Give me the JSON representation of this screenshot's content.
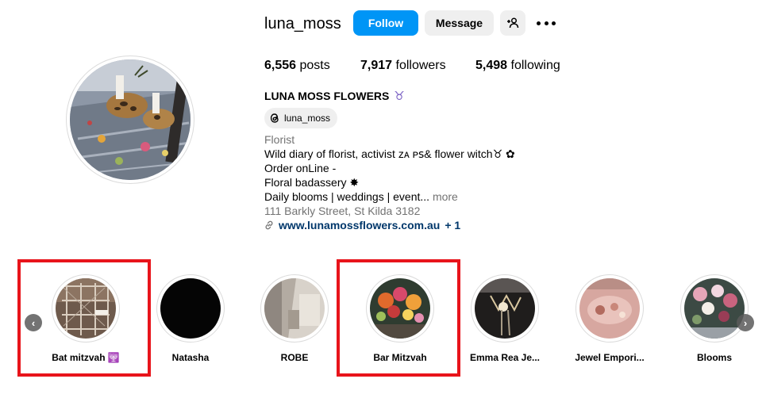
{
  "profile": {
    "username": "luna_moss",
    "follow_label": "Follow",
    "message_label": "Message",
    "stats": {
      "posts_count": "6,556",
      "posts_label": "posts",
      "followers_count": "7,917",
      "followers_label": "followers",
      "following_count": "5,498",
      "following_label": "following"
    },
    "full_name": "LUNA MOSS FLOWERS",
    "name_symbol": "♉",
    "threads_handle": "luna_moss",
    "category": "Florist",
    "bio_line1": "Wild diary of florist, activist ᴢᴀ ᴘꜱ& flower witch♉ ✿",
    "bio_line2": "Order onLine -",
    "bio_line3": "Floral badassery ✸",
    "bio_line4": "Daily blooms | weddings | event...",
    "more_label": "more",
    "address": "111 Barkly Street, St Kilda 3182",
    "website": "www.lunamossflowers.com.au",
    "website_extra": "+ 1"
  },
  "highlights": [
    {
      "label": "Bat mitzvah 🕎",
      "highlighted": true
    },
    {
      "label": "Natasha",
      "highlighted": false
    },
    {
      "label": "ROBE",
      "highlighted": false
    },
    {
      "label": "Bar Mitzvah",
      "highlighted": true
    },
    {
      "label": "Emma Rea Je...",
      "highlighted": false
    },
    {
      "label": "Jewel Empori...",
      "highlighted": false
    },
    {
      "label": "Blooms",
      "highlighted": false
    }
  ],
  "nav": {
    "prev_icon": "chevron-left-icon",
    "next_icon": "chevron-right-icon"
  },
  "colors": {
    "follow_button": "#0095f6",
    "annotation_box": "#e8141b",
    "link": "#00376b"
  }
}
